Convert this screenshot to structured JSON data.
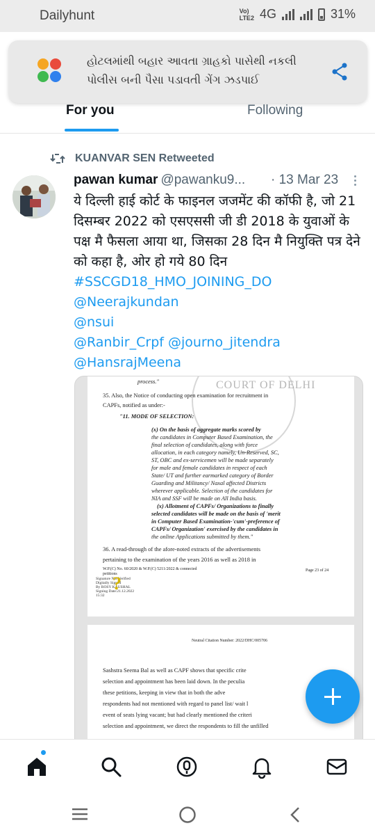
{
  "status_bar": {
    "app_name": "Dailyhunt",
    "network_label": "4G",
    "volte_label": "VoLTE",
    "battery": "31%"
  },
  "notification": {
    "text": "હોટલમાંથી બહાર આવતા ગ્રાહકો પાસેથી નકલી પોલીસ બની પૈસા પડાવતી ગેંગ ઝડપાઈ",
    "logo_colors": [
      "#f5a623",
      "#e94b3c",
      "#3fb950",
      "#2f80ed"
    ],
    "share_icon": "share-icon"
  },
  "tabs": [
    {
      "label": "For you",
      "active": true
    },
    {
      "label": "Following",
      "active": false
    }
  ],
  "tweet": {
    "retweeted_by": "KUANVAR SEN Retweeted",
    "author_name": "pawan kumar",
    "author_handle": "@pawanku9...",
    "date": "· 13 Mar 23",
    "text": "ये दिल्ली हाई कोर्ट के फाइनल जजमेंट की कॉफी है, जो 21 दिसम्बर 2022 को एसएससी जी डी 2018 के युवाओं के पक्ष मै फैसला आया था, जिसका 28 दिन मै नियुक्ति पत्र देने को कहा है, ओर हो गये 80 दिन",
    "hashtag": "#SSCGD18_HMO_JOINING_DO",
    "mentions": [
      "@Neerajkundan",
      "@nsui",
      "@Ranbir_Crpf @journo_jitendra",
      "@HansrajMeena"
    ]
  },
  "document": {
    "seal_text": "COURT OF DELHI",
    "page1_lines": [
      "process.\"",
      "35.    Also, the Notice of conducting open examination for recruitment in",
      "CAPFs, notified as under:-",
      "\"11. MODE OF SELECTION:",
      "(x)     On the basis of aggregate marks scored by",
      "the candidates in Computer Based Examination, the",
      "final selection of candidates, along with force",
      "allocation, in each category namely, Un-Reserved, SC,",
      "ST, OBC and ex-servicemen will be made separately",
      "for male and female candidates in respect of each",
      "State/ UT and further earmarked category of Border",
      "Guarding and Militancy/ Naxal affected Districts",
      "wherever applicable. Selection of the candidates for",
      "NIA and SSF will be made on All India basis.",
      "(x) Allotment of CAPFs/ Organizations to finally",
      "selected candidates will be made on the basis of 'merit",
      "in Computer Based Examination-'cum'-preference of",
      "CAPFs/ Organization' exercised by the candidates in",
      "the online Applications submitted by them.\"",
      "36.    A read-through of the afore-noted extracts of the advertisements",
      "pertaining to the examination of the years 2016 as well as 2018 in"
    ],
    "page1_footer_left": "W.P.(C) No. 60/2020 & W.P.(C) 5211/2022 & connected petitions",
    "page1_footer_right": "Page 23 of 24",
    "signature_lines": [
      "Signature Not Verified",
      "Digitally Signed",
      "By ROSY KAUSHAL",
      "Signing Date:21.12.2022",
      "15:32"
    ],
    "page2_header": "Neutral Citation Number: 2022/DHC/005706",
    "page2_lines": [
      "Sashstra Seema Bal as well as CAPF shows that specific crite",
      "selection and appointment has been laid down. In the peculia",
      "these petitions, keeping in view that in both the adve",
      "respondents had not mentioned with regard to panel list/ wait l",
      "event of seats lying vacant; but had clearly mentioned the criteri",
      "selection and appointment, we direct the respondents to fill the unfilled"
    ]
  },
  "bottom_nav": [
    "home-icon",
    "search-icon",
    "spaces-icon",
    "notifications-icon",
    "messages-icon"
  ],
  "system_nav": [
    "recents-button",
    "home-button",
    "back-button"
  ],
  "colors": {
    "accent": "#1d9bf0",
    "text_primary": "#0f1419",
    "text_secondary": "#536471"
  }
}
